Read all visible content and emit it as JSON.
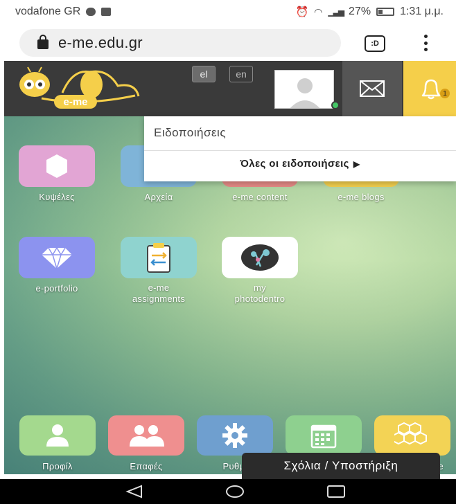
{
  "status_bar": {
    "carrier": "vodafone GR",
    "battery": "27%",
    "time": "1:31 μ.μ."
  },
  "browser": {
    "url": "e-me.edu.gr",
    "tab_badge": ":D"
  },
  "header": {
    "logo_text": "e-me",
    "lang_el": "el",
    "lang_en": "en",
    "notification_count": "1"
  },
  "notifications": {
    "title": "Ειδοποιήσεις",
    "all_link": "Όλες οι ειδοποιήσεις"
  },
  "apps": [
    {
      "label": "Κυψέλες",
      "color": "#e2a5d4",
      "icon": "hexagon-icon"
    },
    {
      "label": "Αρχεία",
      "color": "#7fb4d8",
      "icon": "folder-icon"
    },
    {
      "label": "e-me content",
      "color": "#e58a86",
      "icon": "content-icon"
    },
    {
      "label": "e-me blogs",
      "color": "#f2cf4e",
      "icon": "blog-icon"
    },
    {
      "label": "e-portfolio",
      "color": "#8c93ef",
      "icon": "diamond-icon"
    },
    {
      "label": "e-me assignments",
      "label_line1": "e-me",
      "label_line2": "assignments",
      "color": "#8fd3cf",
      "icon": "assignments-icon"
    },
    {
      "label": "my photodentro",
      "label_line1": "my",
      "label_line2": "photodentro",
      "color": "#ffffff",
      "icon": "photodentro-icon"
    }
  ],
  "tray": [
    {
      "label": "Προφίλ",
      "color": "#a4d98e",
      "icon": "profile-icon"
    },
    {
      "label": "Επαφές",
      "color": "#ef8f8f",
      "icon": "contacts-icon"
    },
    {
      "label": "Ρυθμί",
      "color": "#6f9fcf",
      "icon": "gear-icon"
    },
    {
      "label": "",
      "color": "#8ed08f",
      "icon": "calendar-icon"
    },
    {
      "label": "e",
      "color": "#f3d355",
      "icon": "hive-icon"
    }
  ],
  "support_button": "Σχόλια / Υποστήριξη"
}
